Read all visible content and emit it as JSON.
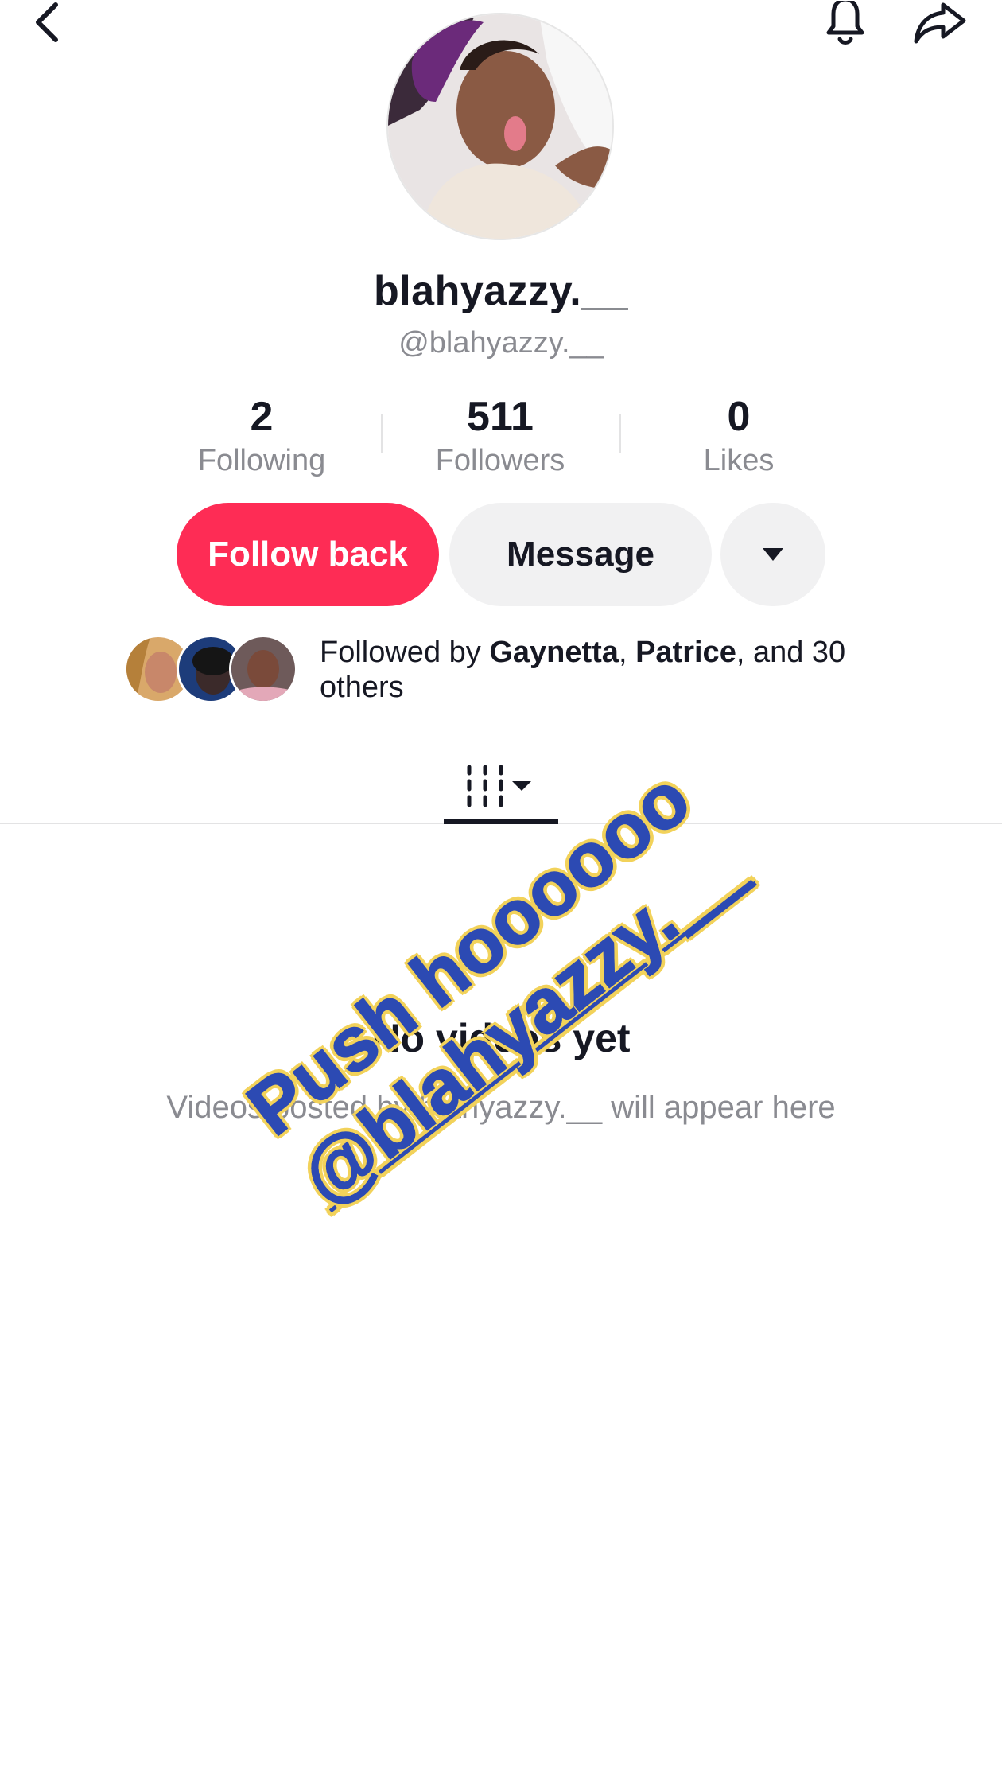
{
  "topbar": {
    "back_icon": "chevron-left-icon",
    "notification_icon": "bell-icon",
    "share_icon": "share-arrow-icon"
  },
  "profile": {
    "display_name": "blahyazzy.__",
    "handle": "@blahyazzy.__"
  },
  "stats": [
    {
      "value": "2",
      "label": "Following"
    },
    {
      "value": "511",
      "label": "Followers"
    },
    {
      "value": "0",
      "label": "Likes"
    }
  ],
  "actions": {
    "follow_label": "Follow back",
    "message_label": "Message",
    "more_icon": "caret-down-icon"
  },
  "followed_by": {
    "prefix": "Followed by ",
    "name1": "Gaynetta",
    "sep": ", ",
    "name2": "Patrice",
    "suffix": ", and 30 others"
  },
  "tabs": {
    "videos_icon": "videos-grid-icon"
  },
  "empty_state": {
    "title": "No videos yet",
    "subtitle": "Videos posted by blahyazzy.__ will appear here"
  },
  "sticker": {
    "line1": "Push hoooooo",
    "line2": "@blahyazzy.__"
  },
  "colors": {
    "accent": "#fe2c55",
    "secondary_button": "#f1f1f2",
    "muted_text": "#8a8b91",
    "sticker_text": "#2c4ab3",
    "sticker_outline": "#f2d25a"
  }
}
